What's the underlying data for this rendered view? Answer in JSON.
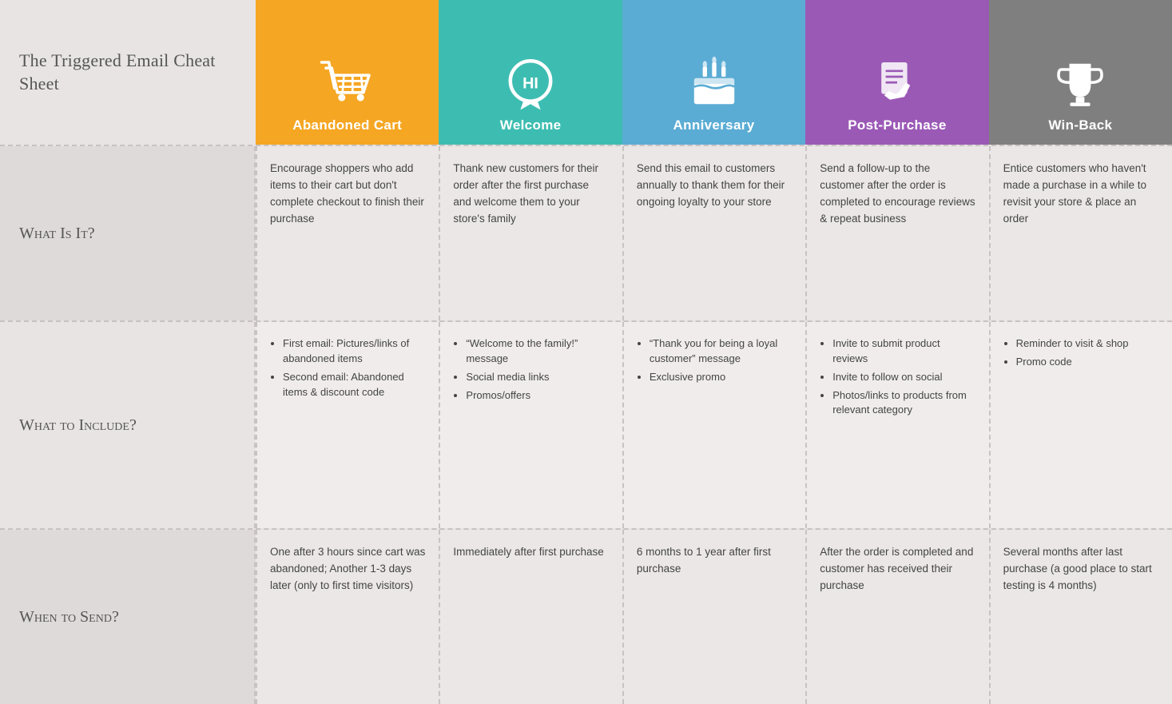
{
  "header": {
    "title": "The Triggered Email Cheat Sheet",
    "columns": [
      {
        "id": "abandoned-cart",
        "label": "Abandoned Cart",
        "color": "orange",
        "icon": "cart"
      },
      {
        "id": "welcome",
        "label": "Welcome",
        "color": "teal",
        "icon": "hi"
      },
      {
        "id": "anniversary",
        "label": "Anniversary",
        "color": "blue",
        "icon": "cake"
      },
      {
        "id": "post-purchase",
        "label": "Post-Purchase",
        "color": "purple",
        "icon": "hand"
      },
      {
        "id": "win-back",
        "label": "Win-Back",
        "color": "gray",
        "icon": "trophy"
      }
    ]
  },
  "rows": [
    {
      "label": "What Is It?",
      "cells": [
        "Encourage shoppers who add items to their cart but don't complete checkout to finish their purchase",
        "Thank new customers for their order after the first purchase and welcome them to your store's family",
        "Send this email to customers annually to thank them for their ongoing loyalty to your store",
        "Send a follow-up to the customer after the order is completed to encourage reviews & repeat business",
        "Entice customers who haven't made a purchase in a while to revisit your store & place an order"
      ],
      "type": "text"
    },
    {
      "label": "What to Include?",
      "cells": [
        [
          "First email: Pictures/links of abandoned items",
          "Second email: Abandoned items & discount code"
        ],
        [
          "“Welcome to the family!” message",
          "Social media links",
          "Promos/offers"
        ],
        [
          "“Thank you for being a loyal customer” message",
          "Exclusive promo"
        ],
        [
          "Invite to submit product reviews",
          "Invite to follow on social",
          "Photos/links to products from relevant category"
        ],
        [
          "Reminder to visit & shop",
          "Promo code"
        ]
      ],
      "type": "list"
    },
    {
      "label": "When to Send?",
      "cells": [
        "One after 3 hours since cart was abandoned; Another 1-3 days later (only to first time visitors)",
        "Immediately after first purchase",
        "6 months to 1 year after first purchase",
        "After the order is completed and customer has received their purchase",
        "Several months after last purchase (a good place to start testing is 4 months)"
      ],
      "type": "text"
    }
  ]
}
